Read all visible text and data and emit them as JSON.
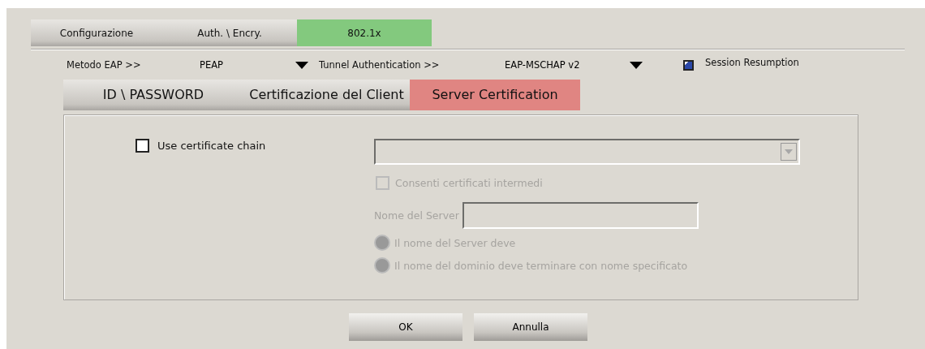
{
  "tabs": [
    {
      "label": "Configurazione",
      "selected": false
    },
    {
      "label": "Auth. \\ Encry.",
      "selected": false
    },
    {
      "label": "802.1x",
      "selected": true
    }
  ],
  "eap_row": {
    "method_label": "Metodo EAP >>",
    "method_value": "PEAP",
    "tunnel_label": "Tunnel Authentication >>",
    "tunnel_value": "EAP-MSCHAP v2",
    "session_resumption": {
      "label": "Session Resumption",
      "checked": true
    }
  },
  "subtabs": [
    {
      "label": "ID \\ PASSWORD",
      "selected": false
    },
    {
      "label": "Certificazione del Client",
      "selected": false
    },
    {
      "label": "Server Certification",
      "selected": true
    }
  ],
  "panel": {
    "use_certificate_chain": {
      "label": "Use certificate chain",
      "checked": false,
      "disabled": false
    },
    "certificate_select": {
      "disabled": true
    },
    "allow_intermediate": {
      "label": "Consenti certificati intermedi",
      "checked": false,
      "disabled": true
    },
    "server_name": {
      "label": "Nome del Server",
      "disabled": true
    },
    "radios": [
      {
        "label": "Il nome del Server deve",
        "selected": false,
        "disabled": true
      },
      {
        "label": "Il nome del dominio deve terminare con nome specificato",
        "selected": false,
        "disabled": true
      }
    ]
  },
  "buttons": [
    "OK",
    "Annulla"
  ]
}
